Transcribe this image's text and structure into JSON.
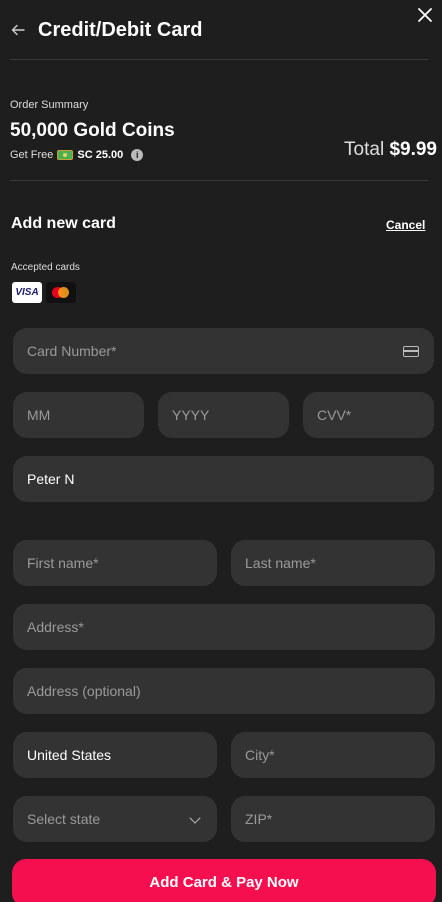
{
  "header": {
    "title": "Credit/Debit Card"
  },
  "order": {
    "label": "Order Summary",
    "product": "50,000 Gold Coins",
    "get_free_prefix": "Get Free",
    "bonus": "SC 25.00",
    "total_label": "Total",
    "total_value": "$9.99"
  },
  "card_section": {
    "title": "Add new card",
    "cancel_label": "Cancel",
    "accepted_label": "Accepted cards",
    "brands": [
      "VISA",
      "Mastercard"
    ]
  },
  "fields": {
    "card_number_placeholder": "Card Number*",
    "month_placeholder": "MM",
    "year_placeholder": "YYYY",
    "cvv_placeholder": "CVV*",
    "name_on_card_value": "Peter N",
    "first_name_placeholder": "First name*",
    "last_name_placeholder": "Last name*",
    "address_placeholder": "Address*",
    "address2_placeholder": "Address (optional)",
    "country_value": "United States",
    "city_placeholder": "City*",
    "state_placeholder": "Select state",
    "zip_placeholder": "ZIP*"
  },
  "actions": {
    "submit_label": "Add Card & Pay Now"
  },
  "colors": {
    "background": "#1e1e1e",
    "field": "#333333",
    "accent": "#f50f4f"
  },
  "icons": [
    "back-arrow-icon",
    "close-icon",
    "money-icon",
    "info-icon",
    "credit-card-icon",
    "chevron-down-icon"
  ]
}
